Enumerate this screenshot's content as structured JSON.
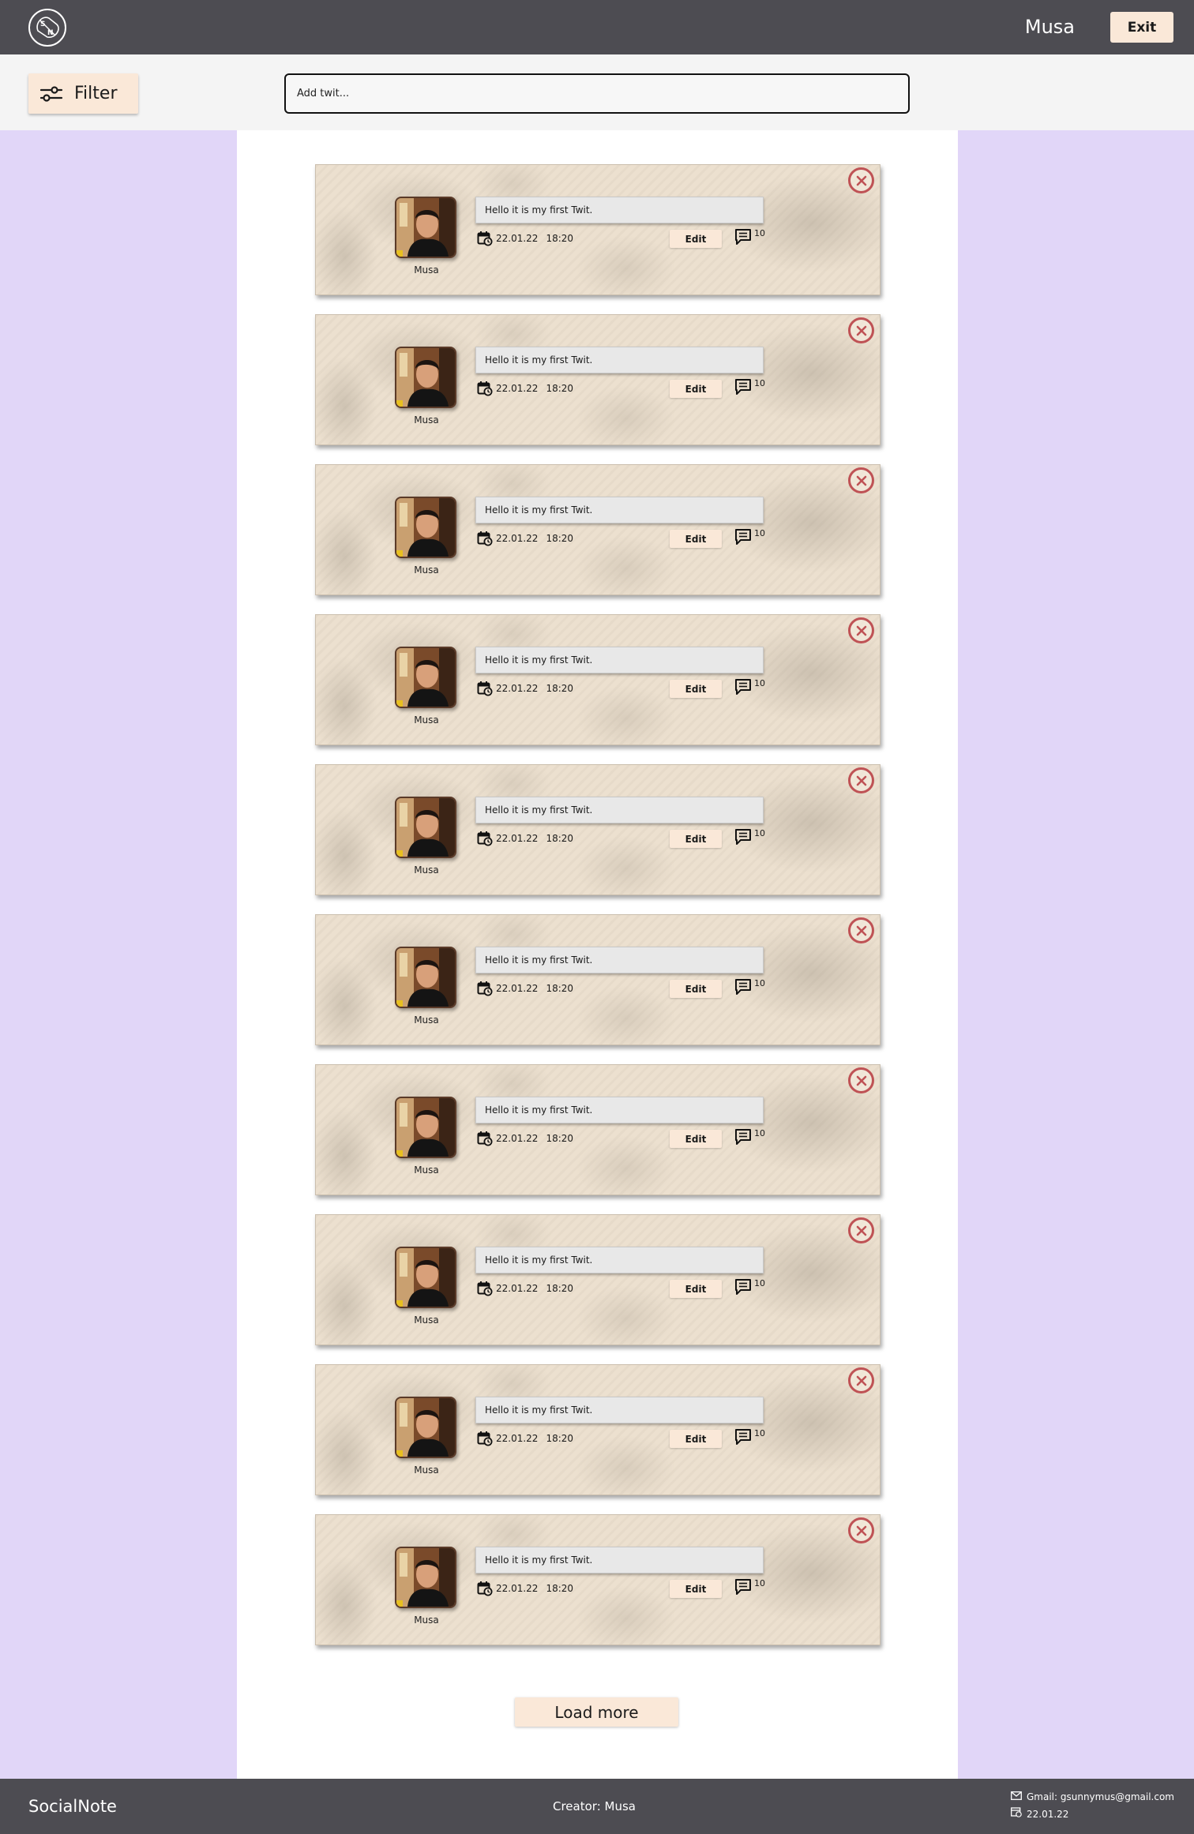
{
  "header": {
    "logo_icon": "social-note-logo-icon",
    "username": "Musa",
    "exit_label": "Exit"
  },
  "toolbar": {
    "filter_label": "Filter",
    "filter_icon": "sliders-icon",
    "add_placeholder": "Add twit..."
  },
  "feed": {
    "posts": [
      {
        "author": "Musa",
        "text": "Hello it is my first Twit.",
        "date": "22.01.22",
        "time": "18:20",
        "edit_label": "Edit",
        "comments": "10"
      },
      {
        "author": "Musa",
        "text": "Hello it is my first Twit.",
        "date": "22.01.22",
        "time": "18:20",
        "edit_label": "Edit",
        "comments": "10"
      },
      {
        "author": "Musa",
        "text": "Hello it is my first Twit.",
        "date": "22.01.22",
        "time": "18:20",
        "edit_label": "Edit",
        "comments": "10"
      },
      {
        "author": "Musa",
        "text": "Hello it is my first Twit.",
        "date": "22.01.22",
        "time": "18:20",
        "edit_label": "Edit",
        "comments": "10"
      },
      {
        "author": "Musa",
        "text": "Hello it is my first Twit.",
        "date": "22.01.22",
        "time": "18:20",
        "edit_label": "Edit",
        "comments": "10"
      },
      {
        "author": "Musa",
        "text": "Hello it is my first Twit.",
        "date": "22.01.22",
        "time": "18:20",
        "edit_label": "Edit",
        "comments": "10"
      },
      {
        "author": "Musa",
        "text": "Hello it is my first Twit.",
        "date": "22.01.22",
        "time": "18:20",
        "edit_label": "Edit",
        "comments": "10"
      },
      {
        "author": "Musa",
        "text": "Hello it is my first Twit.",
        "date": "22.01.22",
        "time": "18:20",
        "edit_label": "Edit",
        "comments": "10"
      },
      {
        "author": "Musa",
        "text": "Hello it is my first Twit.",
        "date": "22.01.22",
        "time": "18:20",
        "edit_label": "Edit",
        "comments": "10"
      },
      {
        "author": "Musa",
        "text": "Hello it is my first Twit.",
        "date": "22.01.22",
        "time": "18:20",
        "edit_label": "Edit",
        "comments": "10"
      }
    ],
    "load_more_label": "Load more"
  },
  "footer": {
    "brand": "SocialNote",
    "creator": "Creator: Musa",
    "email": "Gmail: gsunnymus@gmail.com",
    "date": "22.01.22"
  },
  "colors": {
    "bar": "#4d4c52",
    "accent_button": "#fae8d8",
    "side_background": "#e1d6f8",
    "close_icon": "#bf5255"
  }
}
